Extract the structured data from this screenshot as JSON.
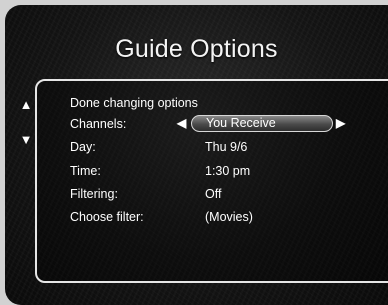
{
  "title": "Guide Options",
  "menu": {
    "done": "Done changing options",
    "rows": [
      {
        "label": "Channels:",
        "value": "You Receive"
      },
      {
        "label": "Day:",
        "value": "Thu 9/6"
      },
      {
        "label": "Time:",
        "value": "1:30 pm"
      },
      {
        "label": "Filtering:",
        "value": "Off"
      },
      {
        "label": "Choose filter:",
        "value": "(Movies)"
      }
    ]
  },
  "icons": {
    "scroll_up": "arrow-up-icon",
    "scroll_down": "arrow-down-icon",
    "select_left": "arrow-left-icon",
    "select_right": "arrow-right-icon"
  }
}
